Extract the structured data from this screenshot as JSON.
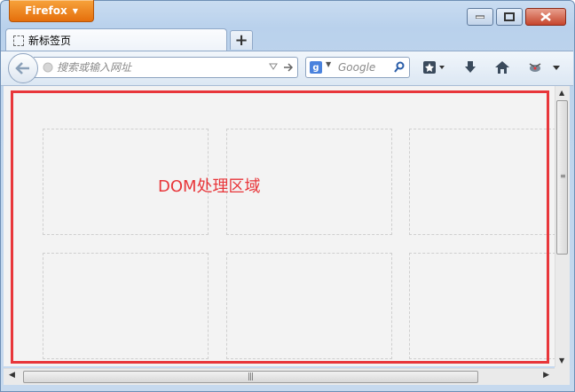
{
  "app": {
    "button_label": "Firefox",
    "button_arrow": "▼"
  },
  "window_controls": {
    "minimize": "minimize-icon",
    "maximize": "maximize-icon",
    "close": "close-icon"
  },
  "tabs": [
    {
      "title": "新标签页",
      "icon": "blank-page-icon"
    }
  ],
  "new_tab": {
    "label": "+"
  },
  "urlbar": {
    "placeholder": "搜索或输入网址"
  },
  "search": {
    "engine_letter": "g",
    "placeholder": "Google"
  },
  "toolbar_icons": [
    "bookmarks-icon",
    "download-icon",
    "home-icon",
    "addon-icon",
    "menu-icon"
  ],
  "content": {
    "highlight_label": "DOM处理区域",
    "highlight_color": "#e8363a",
    "tile_count": 6
  },
  "scrollbars": {
    "vertical_grip": "≡",
    "horizontal_grip": "|||"
  }
}
